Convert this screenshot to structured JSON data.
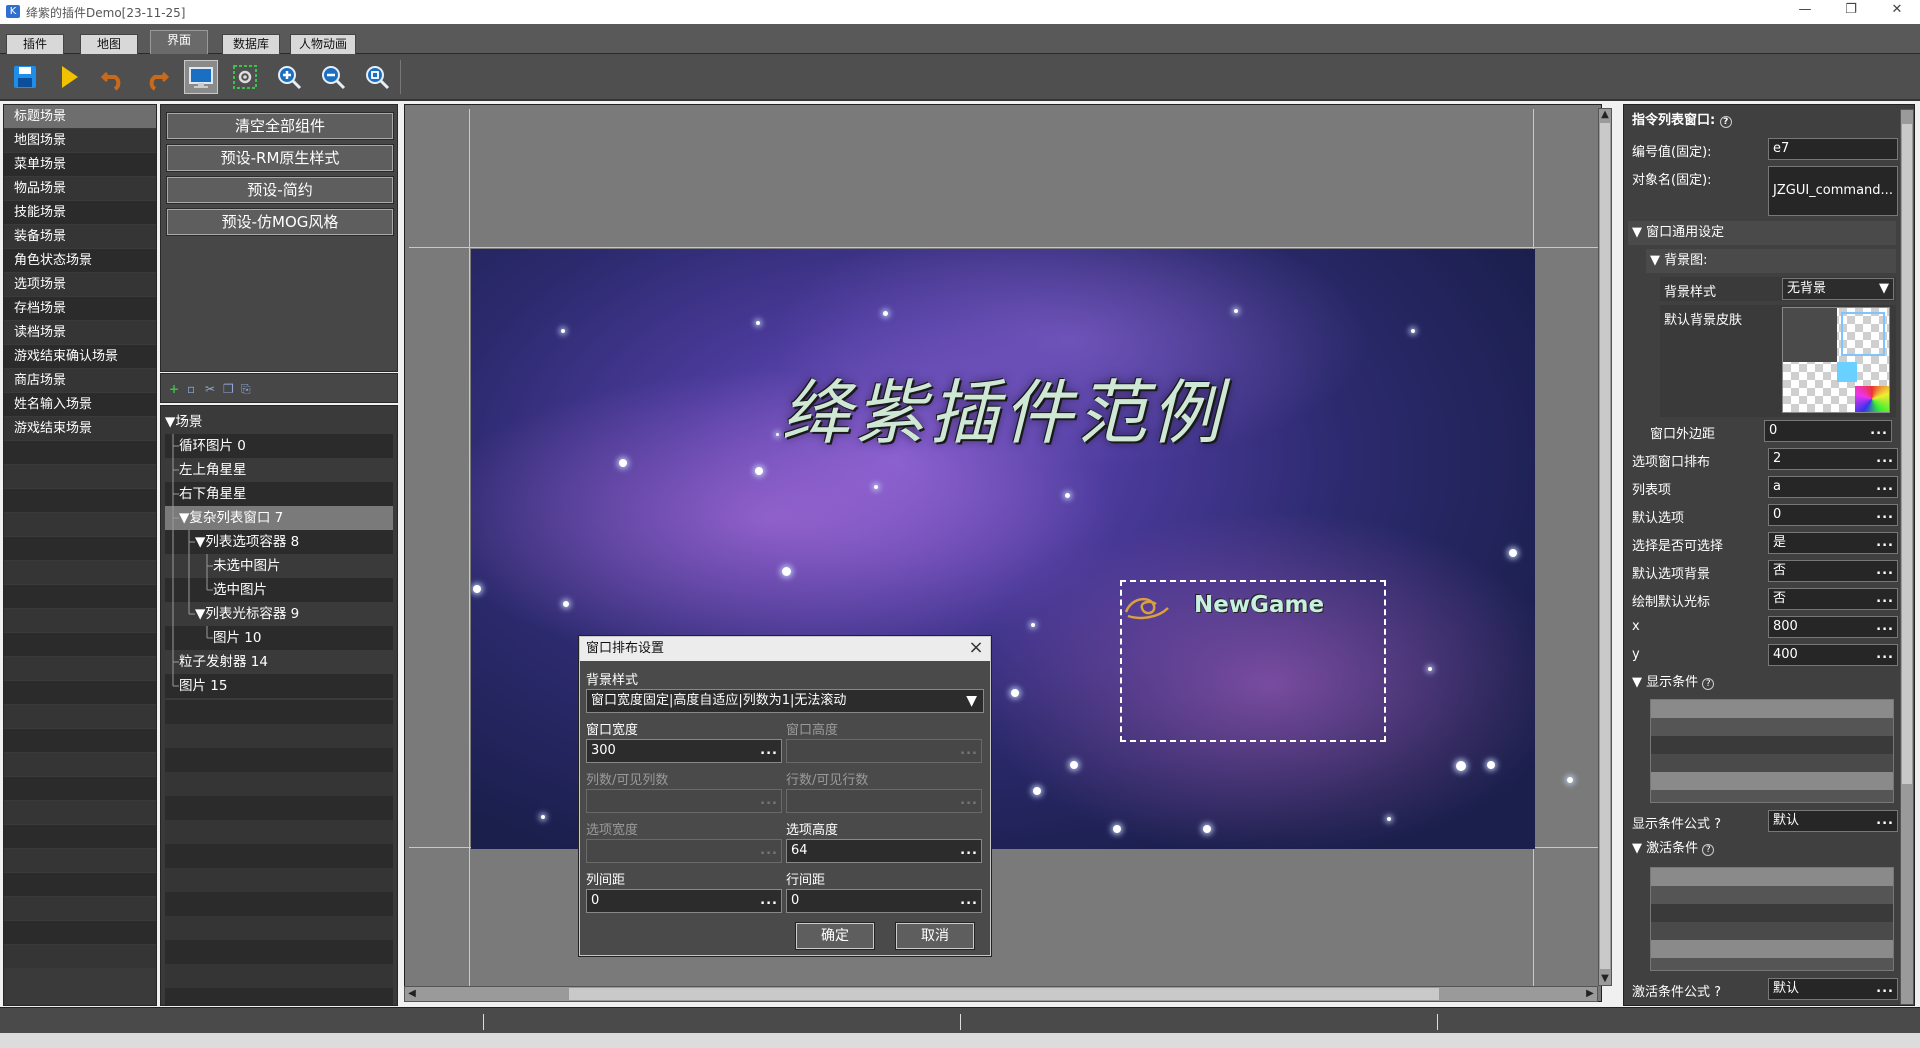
{
  "window": {
    "title": "绛紫的插件Demo[23-11-25]",
    "controls": [
      "—",
      "❐",
      "✕"
    ]
  },
  "menu_tabs": [
    {
      "label": "插件",
      "active": false
    },
    {
      "label": "地图",
      "active": false
    },
    {
      "label": "界面",
      "active": true
    },
    {
      "label": "数据库",
      "active": false
    },
    {
      "label": "人物动画",
      "active": false
    }
  ],
  "toolbar": {
    "icons": [
      "save-icon",
      "play-icon",
      "undo-icon",
      "redo-icon",
      "monitor-icon",
      "settings-icon",
      "zoom-in-icon",
      "zoom-out-icon",
      "zoom-reset-icon"
    ]
  },
  "scenes": [
    "标题场景",
    "地图场景",
    "菜单场景",
    "物品场景",
    "技能场景",
    "装备场景",
    "角色状态场景",
    "选项场景",
    "存档场景",
    "读档场景",
    "游戏结束确认场景",
    "商店场景",
    "姓名输入场景",
    "游戏结束场景"
  ],
  "presets": [
    "清空全部组件",
    "预设-RM原生样式",
    "预设-简约",
    "预设-仿MOG风格"
  ],
  "tree": {
    "root": "场景",
    "nodes": [
      {
        "label": "循环图片 0",
        "indent": 0,
        "expander": false
      },
      {
        "label": "左上角星星",
        "indent": 0,
        "expander": false
      },
      {
        "label": "右下角星星",
        "indent": 0,
        "expander": false
      },
      {
        "label": "复杂列表窗口 7",
        "indent": 0,
        "expander": true,
        "selected": true
      },
      {
        "label": "列表选项容器 8",
        "indent": 1,
        "expander": true
      },
      {
        "label": "未选中图片",
        "indent": 2,
        "expander": false
      },
      {
        "label": "选中图片",
        "indent": 2,
        "expander": false
      },
      {
        "label": "列表光标容器 9",
        "indent": 1,
        "expander": true
      },
      {
        "label": "图片 10",
        "indent": 2,
        "expander": false
      },
      {
        "label": "粒子发射器 14",
        "indent": 0,
        "expander": false
      },
      {
        "label": "图片 15",
        "indent": 0,
        "expander": false
      }
    ]
  },
  "game": {
    "title": "绛紫插件范例",
    "menu_item": "NewGame"
  },
  "props": {
    "header": "指令列表窗口:",
    "id_label": "编号值(固定):",
    "id_value": "e7",
    "name_label": "对象名(固定):",
    "name_value": "JZGUI_command...",
    "sec_window": "窗口通用设定",
    "sec_bg": "背景图:",
    "bg_style_label": "背景样式",
    "bg_style_value": "无背景",
    "bg_skin_label": "默认背景皮肤",
    "margin_label": "窗口外边距",
    "margin_value": "0",
    "rows": [
      {
        "label": "选项窗口排布",
        "value": "2"
      },
      {
        "label": "列表项",
        "value": "a"
      },
      {
        "label": "默认选项",
        "value": "0"
      },
      {
        "label": "选择是否可选择",
        "value": "是"
      },
      {
        "label": "默认选项背景",
        "value": "否"
      },
      {
        "label": "绘制默认光标",
        "value": "否"
      },
      {
        "label": "x",
        "value": "800"
      },
      {
        "label": "y",
        "value": "400"
      }
    ],
    "sec_show": "显示条件",
    "show_formula_label": "显示条件公式",
    "show_formula_value": "默认",
    "sec_activate": "激活条件",
    "activate_formula_label": "激活条件公式",
    "activate_formula_value": "默认",
    "dots": "..."
  },
  "dialog": {
    "title": "窗口排布设置",
    "bg_style_label": "背景样式",
    "bg_style_value": "窗口宽度固定|高度自适应|列数为1|无法滚动",
    "width_label": "窗口宽度",
    "width_value": "300",
    "height_label": "窗口高度",
    "height_value": "",
    "cols_label": "列数/可见列数",
    "cols_value": "",
    "rows_label": "行数/可见行数",
    "rows_value": "",
    "item_w_label": "选项宽度",
    "item_w_value": "",
    "item_h_label": "选项高度",
    "item_h_value": "64",
    "col_gap_label": "列间距",
    "col_gap_value": "0",
    "row_gap_label": "行间距",
    "row_gap_value": "0",
    "ok": "确定",
    "cancel": "取消",
    "dots": "..."
  },
  "colors": {
    "accent_green": "#3cc24a",
    "bg_dark": "#404040",
    "selection": "#7a7a7a"
  }
}
